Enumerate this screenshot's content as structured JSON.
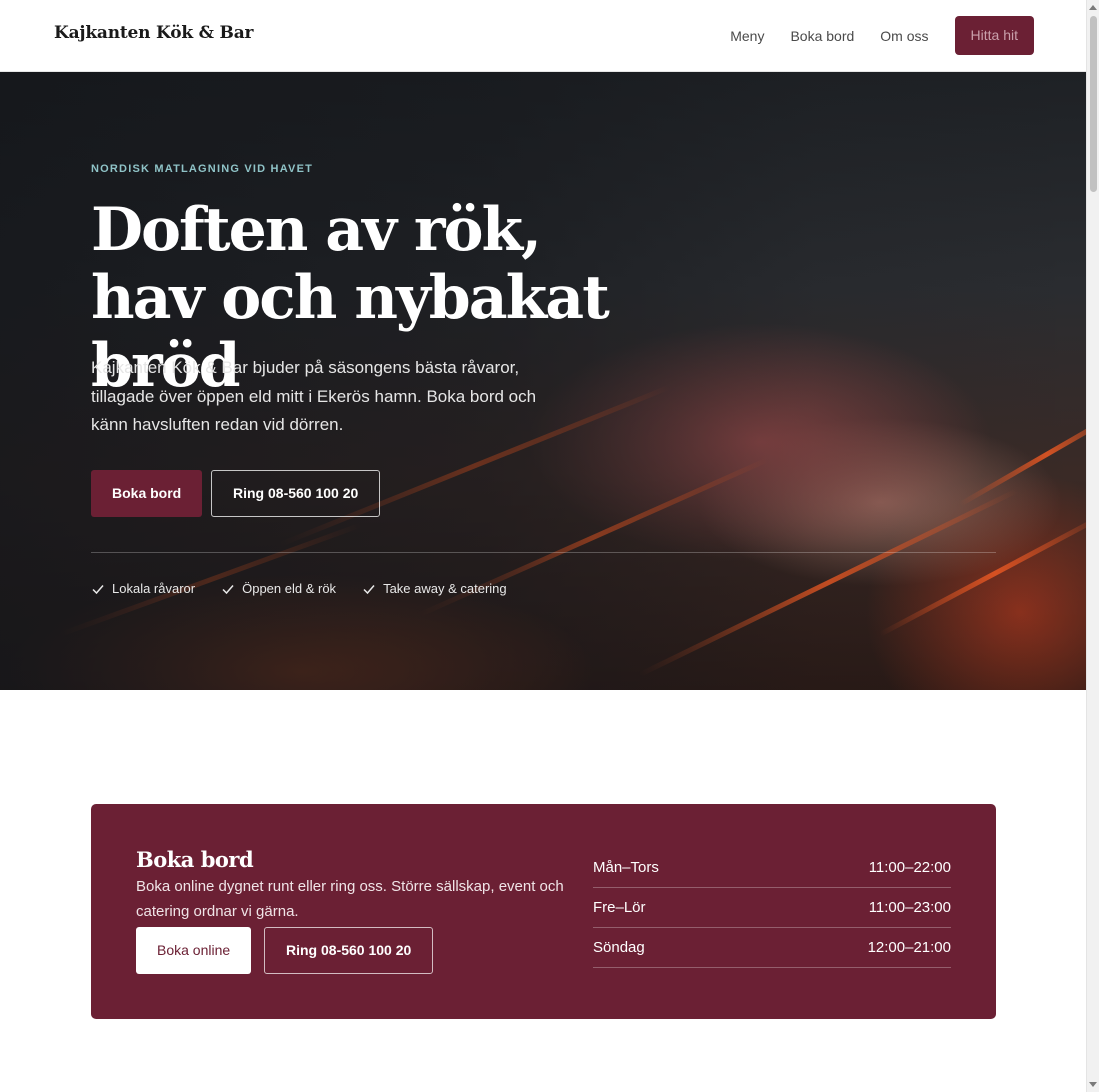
{
  "header": {
    "logo": "Kajkanten Kök & Bar",
    "nav": [
      "Meny",
      "Boka bord",
      "Om oss"
    ],
    "cta": "Hitta hit"
  },
  "hero": {
    "eyebrow": "NORDISK MATLAGNING VID HAVET",
    "title": "Doften av rök, hav och nybakat bröd",
    "text": "Kajkanten Kök & Bar bjuder på säsongens bästa råvaror, tillagade över öppen eld mitt i Ekerös hamn. Boka bord och känn havsluften redan vid dörren.",
    "primary_button": "Boka bord",
    "secondary_button": "Ring 08-560 100 20",
    "features": [
      "Lokala råvaror",
      "Öppen eld & rök",
      "Take away & catering"
    ]
  },
  "booking": {
    "title": "Boka bord",
    "text": "Boka online dygnet runt eller ring oss. Större sällskap, event och catering ordnar vi gärna.",
    "online_button": "Boka online",
    "call_button": "Ring 08-560 100 20",
    "hours": [
      {
        "day": "Mån–Tors",
        "time": "11:00–22:00"
      },
      {
        "day": "Fre–Lör",
        "time": "11:00–23:00"
      },
      {
        "day": "Söndag",
        "time": "12:00–21:00"
      }
    ]
  },
  "colors": {
    "brand": "#6b2034",
    "eyebrow": "#8fc3c7"
  }
}
